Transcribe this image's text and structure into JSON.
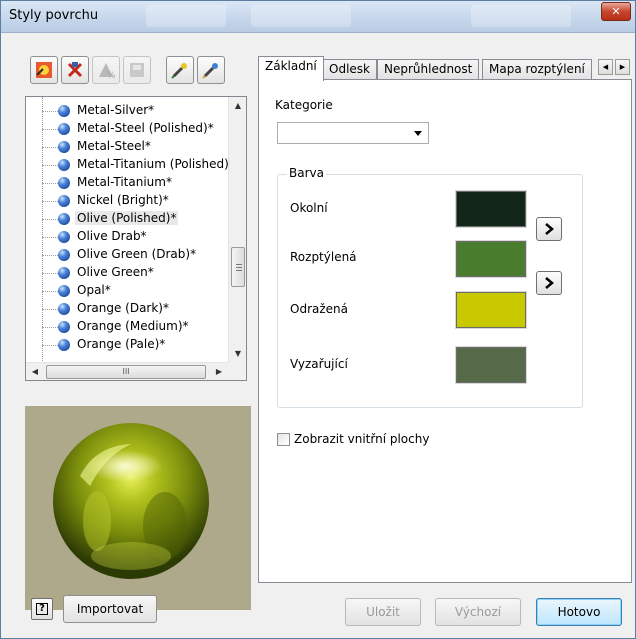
{
  "window": {
    "title": "Styly povrchu",
    "close_glyph": "✕"
  },
  "toolbar": {
    "buttons": [
      {
        "icon": "new-style-icon"
      },
      {
        "icon": "purge-style-icon"
      },
      {
        "icon": "update-style-icon"
      },
      {
        "icon": "save-to-library-icon"
      },
      {
        "icon": "eyedropper-icon"
      },
      {
        "icon": "eyedropper-apply-icon"
      }
    ]
  },
  "style_list": {
    "items": [
      "Metal-Silver*",
      "Metal-Steel (Polished)*",
      "Metal-Steel*",
      "Metal-Titanium (Polished)",
      "Metal-Titanium*",
      "Nickel (Bright)*",
      "Olive (Polished)*",
      "Olive Drab*",
      "Olive Green (Drab)*",
      "Olive Green*",
      "Opal*",
      "Orange (Dark)*",
      "Orange (Medium)*",
      "Orange (Pale)*"
    ],
    "selected": "Olive (Polished)*",
    "hscroll_grip": "III"
  },
  "tabs": [
    "Základní",
    "Odlesk",
    "Neprůhlednost",
    "Mapa rozptýlení"
  ],
  "active_tab": "Základní",
  "basic": {
    "category_label": "Kategorie",
    "category_value": "",
    "color_group": "Barva",
    "colors": [
      {
        "label": "Okolní",
        "hex": "#112618"
      },
      {
        "label": "Rozptýlená",
        "hex": "#4a7c2e"
      },
      {
        "label": "Odražená",
        "hex": "#c9c900"
      },
      {
        "label": "Vyzařující",
        "hex": "#566a4a"
      }
    ],
    "show_inner_faces_label": "Zobrazit vnitřní plochy",
    "show_inner_faces_checked": false
  },
  "footer": {
    "help_glyph": "?",
    "import_label": "Importovat",
    "save_label": "Uložit",
    "default_label": "Výchozí",
    "done_label": "Hotovo"
  }
}
